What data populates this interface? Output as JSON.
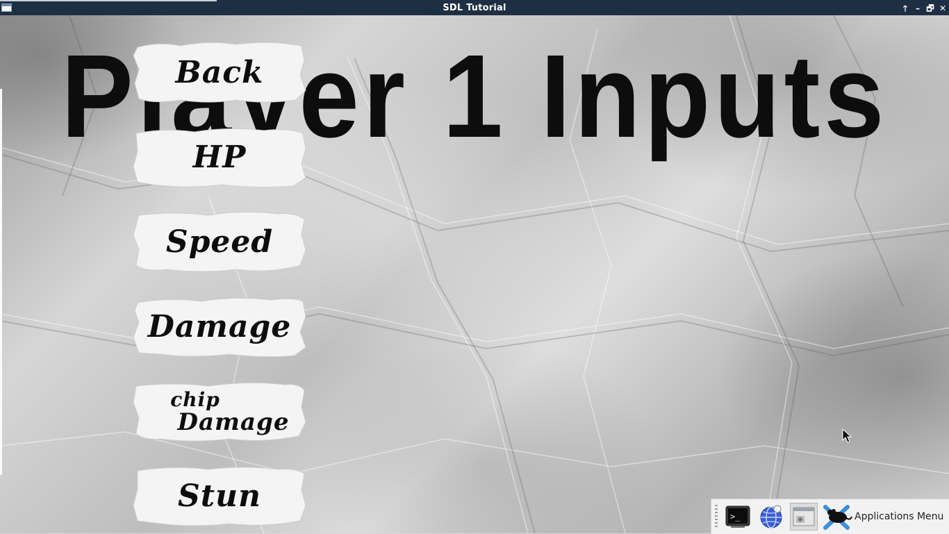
{
  "window": {
    "title": "SDL Tutorial",
    "controls": {
      "keep_above": "🡑",
      "minimize": "–",
      "maximize": "🗗",
      "close": "✕"
    }
  },
  "screen": {
    "heading": "Player 1 Inputs",
    "buttons": [
      {
        "id": "back",
        "label": "Back"
      },
      {
        "id": "hp",
        "label": "HP"
      },
      {
        "id": "speed",
        "label": "Speed"
      },
      {
        "id": "damage",
        "label": "Damage"
      },
      {
        "id": "chip-damage",
        "label_line1": "chip",
        "label_line2": "Damage"
      },
      {
        "id": "stun",
        "label": "Stun"
      }
    ]
  },
  "taskbar": {
    "launchers": [
      {
        "name": "terminal",
        "icon": "terminal-icon"
      },
      {
        "name": "web-browser",
        "icon": "globe-icon"
      },
      {
        "name": "window-list",
        "icon": "window-icon"
      }
    ],
    "applications_menu_label": "Applications Menu",
    "applications_menu_icon": "xfce-mouse-icon"
  },
  "colors": {
    "titlebar": "#1f2f43",
    "ink": "#0d0d0d",
    "paper": "#f4f4f4",
    "panel": "#f2f2f2"
  }
}
